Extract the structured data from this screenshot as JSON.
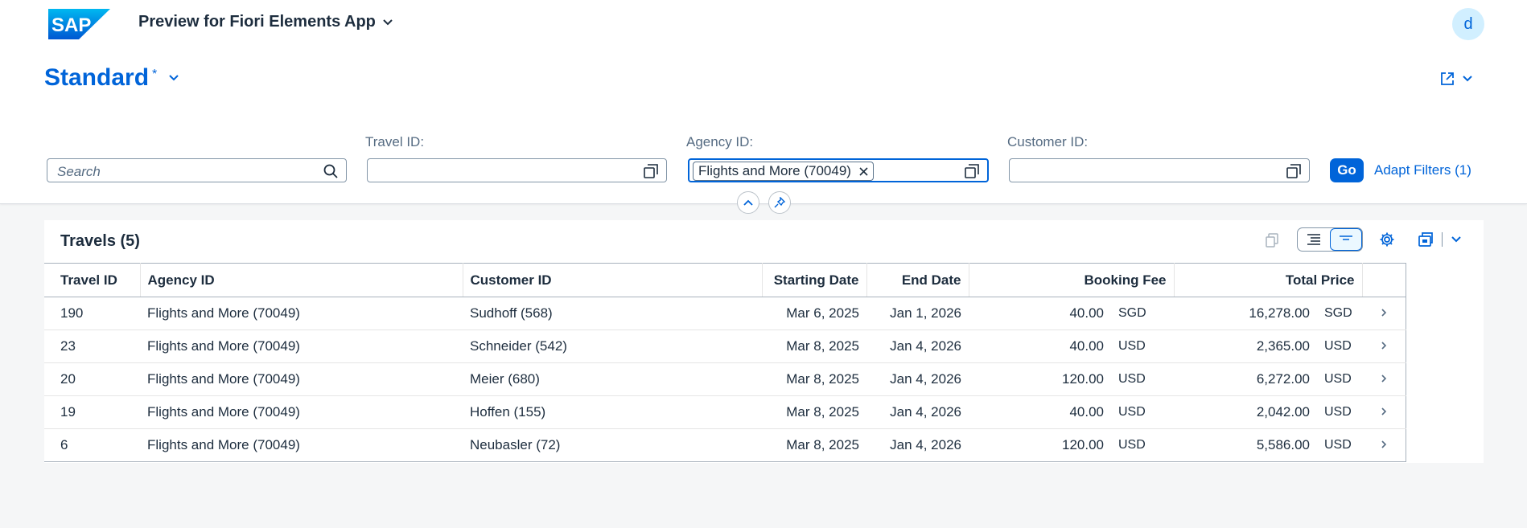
{
  "shell": {
    "app_title": "Preview for Fiori Elements App",
    "avatar_initial": "d",
    "logo_text": "SAP"
  },
  "variant": {
    "name": "Standard",
    "modified_marker": "*"
  },
  "filters": {
    "search_placeholder": "Search",
    "travel_id_label": "Travel ID:",
    "agency_id_label": "Agency ID:",
    "agency_token": "Flights and More (70049)",
    "customer_id_label": "Customer ID:",
    "go_label": "Go",
    "adapt_label": "Adapt Filters (1)"
  },
  "table": {
    "title": "Travels (5)",
    "columns": [
      "Travel ID",
      "Agency ID",
      "Customer ID",
      "Starting Date",
      "End Date",
      "Booking Fee",
      "Total Price"
    ],
    "rows": [
      {
        "travel_id": "190",
        "agency": "Flights and More (70049)",
        "customer": "Sudhoff (568)",
        "start": "Mar 6, 2025",
        "end": "Jan 1, 2026",
        "fee": "40.00",
        "fee_cur": "SGD",
        "total": "16,278.00",
        "total_cur": "SGD"
      },
      {
        "travel_id": "23",
        "agency": "Flights and More (70049)",
        "customer": "Schneider (542)",
        "start": "Mar 8, 2025",
        "end": "Jan 4, 2026",
        "fee": "40.00",
        "fee_cur": "USD",
        "total": "2,365.00",
        "total_cur": "USD"
      },
      {
        "travel_id": "20",
        "agency": "Flights and More (70049)",
        "customer": "Meier (680)",
        "start": "Mar 8, 2025",
        "end": "Jan 4, 2026",
        "fee": "120.00",
        "fee_cur": "USD",
        "total": "6,272.00",
        "total_cur": "USD"
      },
      {
        "travel_id": "19",
        "agency": "Flights and More (70049)",
        "customer": "Hoffen (155)",
        "start": "Mar 8, 2025",
        "end": "Jan 4, 2026",
        "fee": "40.00",
        "fee_cur": "USD",
        "total": "2,042.00",
        "total_cur": "USD"
      },
      {
        "travel_id": "6",
        "agency": "Flights and More (70049)",
        "customer": "Neubasler (72)",
        "start": "Mar 8, 2025",
        "end": "Jan 4, 2026",
        "fee": "120.00",
        "fee_cur": "USD",
        "total": "5,586.00",
        "total_cur": "USD"
      }
    ]
  },
  "colors": {
    "brand": "#0064d9",
    "text": "#1d2d3e",
    "muted": "#556b82"
  }
}
